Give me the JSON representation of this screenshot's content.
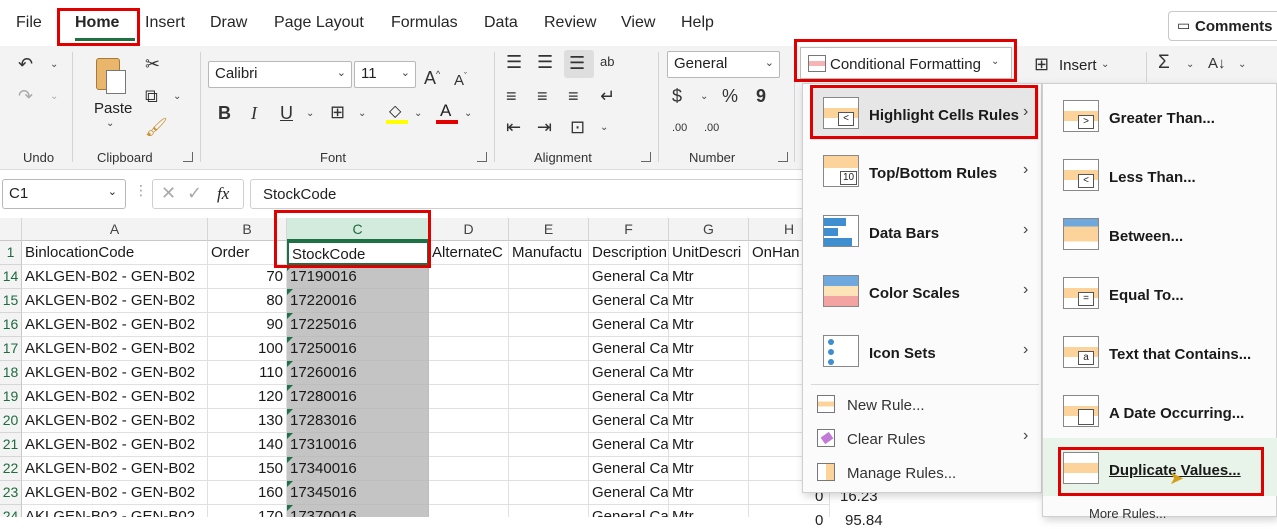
{
  "menu_tabs": [
    "File",
    "Home",
    "Insert",
    "Draw",
    "Page Layout",
    "Formulas",
    "Data",
    "Review",
    "View",
    "Help"
  ],
  "comments_label": "Comments",
  "ribbon": {
    "undo_label": "Undo",
    "clipboard_label": "Clipboard",
    "paste_label": "Paste",
    "font_name": "Calibri",
    "font_size": "11",
    "font_label": "Font",
    "bold": "B",
    "italic": "I",
    "underline": "U",
    "alignment_label": "Alignment",
    "number_format": "General",
    "number_label": "Number",
    "dollar": "$",
    "percent": "%",
    "comma": "9",
    "inc_dec": ".00",
    "conditional_formatting": "Conditional Formatting",
    "insert_label": "Insert",
    "sigma": "Σ"
  },
  "formula_bar": {
    "name_box": "C1",
    "fx": "fx",
    "value": "StockCode"
  },
  "columns": [
    "A",
    "B",
    "C",
    "D",
    "E",
    "F",
    "G",
    "H"
  ],
  "header_row": {
    "num": "1",
    "cells": [
      "BinlocationCode",
      "Order",
      "StockCode",
      "AlternateC",
      "Manufactu",
      "Description",
      "UnitDescri",
      "OnHan"
    ]
  },
  "rows": [
    {
      "num": "14",
      "a": "AKLGEN-B02 - GEN-B02",
      "b": "70",
      "c": "17190016",
      "f": "General Ca",
      "g": "Mtr"
    },
    {
      "num": "15",
      "a": "AKLGEN-B02 - GEN-B02",
      "b": "80",
      "c": "17220016",
      "f": "General Ca",
      "g": "Mtr"
    },
    {
      "num": "16",
      "a": "AKLGEN-B02 - GEN-B02",
      "b": "90",
      "c": "17225016",
      "f": "General Ca",
      "g": "Mtr"
    },
    {
      "num": "17",
      "a": "AKLGEN-B02 - GEN-B02",
      "b": "100",
      "c": "17250016",
      "f": "General Ca",
      "g": "Mtr"
    },
    {
      "num": "18",
      "a": "AKLGEN-B02 - GEN-B02",
      "b": "110",
      "c": "17260016",
      "f": "General Ca",
      "g": "Mtr"
    },
    {
      "num": "19",
      "a": "AKLGEN-B02 - GEN-B02",
      "b": "120",
      "c": "17280016",
      "f": "General Ca",
      "g": "Mtr"
    },
    {
      "num": "20",
      "a": "AKLGEN-B02 - GEN-B02",
      "b": "130",
      "c": "17283016",
      "f": "General Ca",
      "g": "Mtr"
    },
    {
      "num": "21",
      "a": "AKLGEN-B02 - GEN-B02",
      "b": "140",
      "c": "17310016",
      "f": "General Ca",
      "g": "Mtr"
    },
    {
      "num": "22",
      "a": "AKLGEN-B02 - GEN-B02",
      "b": "150",
      "c": "17340016",
      "f": "General Ca",
      "g": "Mtr"
    },
    {
      "num": "23",
      "a": "AKLGEN-B02 - GEN-B02",
      "b": "160",
      "c": "17345016",
      "f": "General Ca",
      "g": "Mtr"
    },
    {
      "num": "24",
      "a": "AKLGEN-B02 - GEN-B02",
      "b": "170",
      "c": "17370016",
      "f": "General Ca",
      "g": "Mtr"
    }
  ],
  "peek": {
    "h23": "0",
    "i23": "16.23",
    "h24": "0",
    "i24": "95.84"
  },
  "cf_menu": [
    {
      "label": "Highlight Cells Rules"
    },
    {
      "label": "Top/Bottom Rules",
      "icon_text": "10"
    },
    {
      "label": "Data Bars"
    },
    {
      "label": "Color Scales"
    },
    {
      "label": "Icon Sets"
    },
    {
      "label": "New Rule..."
    },
    {
      "label": "Clear Rules"
    },
    {
      "label": "Manage Rules..."
    }
  ],
  "highlight_menu": [
    {
      "label": "Greater Than...",
      "glyph": ">"
    },
    {
      "label": "Less Than...",
      "glyph": "<"
    },
    {
      "label": "Between...",
      "glyph": ""
    },
    {
      "label": "Equal To...",
      "glyph": "="
    },
    {
      "label": "Text that Contains...",
      "glyph": "a"
    },
    {
      "label": "A Date Occurring...",
      "glyph": ""
    },
    {
      "label": "Duplicate Values...",
      "glyph": ""
    },
    {
      "label": "More Rules..."
    }
  ],
  "colors": {
    "accent_green": "#1e7145",
    "highlight_red": "#e00000",
    "selection_gray": "#c4c4c4"
  }
}
